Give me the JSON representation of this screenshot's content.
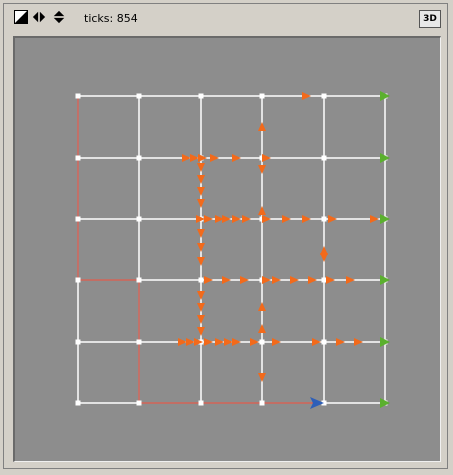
{
  "toolbar": {
    "ticks_label": "ticks: 854",
    "view_3d_label": "3D",
    "icons": [
      "edit-icon",
      "speed-arrows-icon",
      "up-down-arrows-icon"
    ]
  },
  "colors": {
    "view_background": "#8d8d8d",
    "road": "#ffffff",
    "red_road": "#c0392b",
    "car": "#f26a1b",
    "exit_arrow": "#5bb02e",
    "highlight_car": "#2e5fb8"
  },
  "grid": {
    "columns": 6,
    "rows": 6
  }
}
